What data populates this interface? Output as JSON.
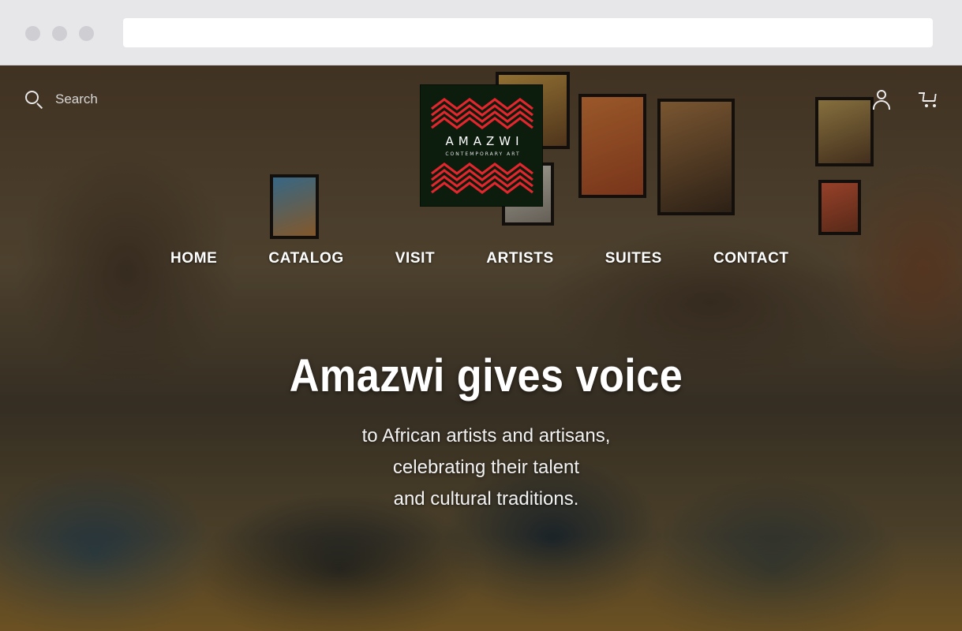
{
  "search": {
    "placeholder": "Search"
  },
  "logo": {
    "name": "AMAZWI",
    "tagline": "CONTEMPORARY ART",
    "accent": "#e3262e",
    "background": "#0c1d0e"
  },
  "nav": {
    "items": [
      "HOME",
      "CATALOG",
      "VISIT",
      "ARTISTS",
      "SUITES",
      "CONTACT"
    ]
  },
  "hero": {
    "title": "Amazwi gives voice",
    "lines": [
      "to African artists and artisans,",
      "celebrating their talent",
      "and cultural traditions."
    ]
  },
  "icons": {
    "search": "search-icon",
    "account": "user-icon",
    "cart": "cart-icon"
  }
}
